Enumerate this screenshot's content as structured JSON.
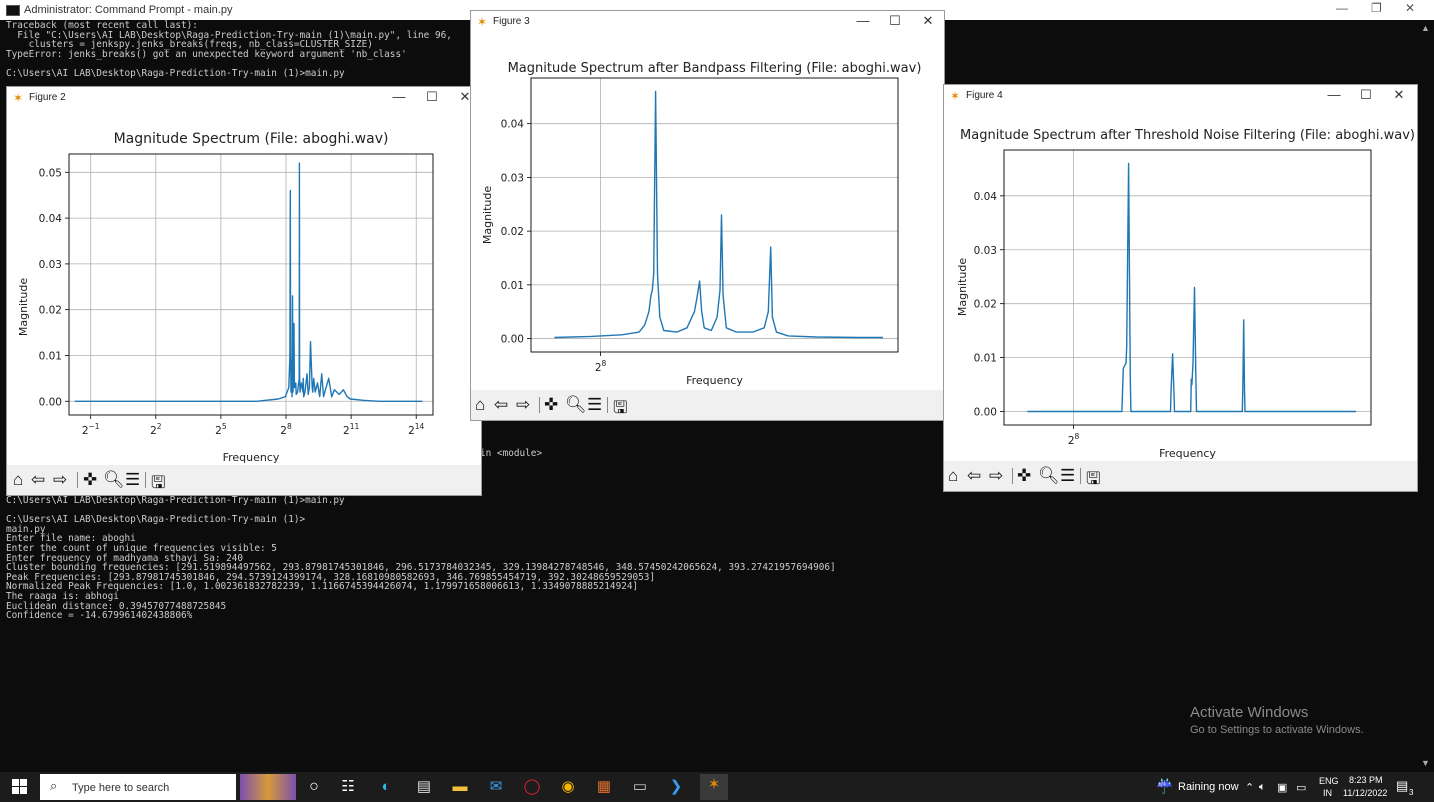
{
  "console": {
    "title": "Administrator: Command Prompt - main.py",
    "top_lines": [
      "Traceback (most recent call last):",
      "  File \"C:\\Users\\AI LAB\\Desktop\\Raga-Prediction-Try-main (1)\\main.py\", line 96,",
      "    clusters = jenkspy.jenks_breaks(freqs, nb_class=CLUSTER_SIZE)",
      "TypeError: jenks_breaks() got an unexpected keyword argument 'nb_class'",
      "",
      "C:\\Users\\AI LAB\\Desktop\\Raga-Prediction-Try-main (1)>main.py"
    ],
    "middle_fragment": "in <module>",
    "bottom_lines": [
      "C:\\Users\\AI LAB\\Desktop\\Raga-Prediction-Try-main (1)>main.py",
      "",
      "C:\\Users\\AI LAB\\Desktop\\Raga-Prediction-Try-main (1)>",
      "main.py",
      "Enter file name: aboghi",
      "Enter the count of unique frequencies visible: 5",
      "Enter frequency of madhyama sthayi Sa: 240",
      "Cluster bounding frequencies: [291.519894497562, 293.87981745301846, 296.5173784032345, 329.13984278748546, 348.57450242065624, 393.27421957694906]",
      "Peak Frequencies: [293.87981745301846, 294.5739124399174, 328.16810980582693, 346.769855454719, 392.30248659529053]",
      "Normalized Peak Frequencies: [1.0, 1.002361832782239, 1.1166745394426074, 1.179971658006613, 1.3349078885214924]",
      "The raaga is: abhogi",
      "Euclidean distance: 0.39457077488725845",
      "Confidence = -14.679961402438806%"
    ]
  },
  "activate_windows": {
    "line1": "Activate Windows",
    "line2": "Go to Settings to activate Windows."
  },
  "figures": [
    {
      "window_title": "Figure 2",
      "chart_data": {
        "type": "line",
        "title": "Magnitude Spectrum (File: aboghi.wav)",
        "xlabel": "Frequency",
        "ylabel": "Magnitude",
        "x_scale": "log2",
        "xlim": [
          0.25,
          28000
        ],
        "ylim": [
          -0.003,
          0.054
        ],
        "grid": true,
        "xticks": [
          {
            "base": "2",
            "exp": "−1",
            "value": 0.5
          },
          {
            "base": "2",
            "exp": "2",
            "value": 4
          },
          {
            "base": "2",
            "exp": "5",
            "value": 32
          },
          {
            "base": "2",
            "exp": "8",
            "value": 256
          },
          {
            "base": "2",
            "exp": "11",
            "value": 2048
          },
          {
            "base": "2",
            "exp": "14",
            "value": 16384
          }
        ],
        "yticks": [
          {
            "label": "0.00",
            "value": 0
          },
          {
            "label": "0.01",
            "value": 0.01
          },
          {
            "label": "0.02",
            "value": 0.02
          },
          {
            "label": "0.03",
            "value": 0.03
          },
          {
            "label": "0.04",
            "value": 0.04
          },
          {
            "label": "0.05",
            "value": 0.05
          }
        ],
        "series": [
          {
            "color": "#1f77b4",
            "x": [
              0.3,
              100,
              200,
              250,
              280,
              290,
              294,
              296,
              300,
              305,
              310,
              315,
              320,
              325,
              330,
              335,
              345,
              350,
              355,
              370,
              390,
              393,
              395,
              400,
              420,
              440,
              445,
              450,
              470,
              500,
              520,
              540,
              560,
              590,
              600,
              620,
              650,
              700,
              750,
              800,
              850,
              900,
              1000,
              1100,
              1200,
              1400,
              1600,
              1800,
              2000,
              3000,
              5000,
              10000,
              20000
            ],
            "y": [
              0,
              0,
              0.0005,
              0.001,
              0.003,
              0.01,
              0.046,
              0.01,
              0.002,
              0.009,
              0.001,
              0.023,
              0.002,
              0.012,
              0.017,
              0.003,
              0.003,
              0.004,
              0.0015,
              0.002,
              0.005,
              0.052,
              0.006,
              0.002,
              0.004,
              0.002,
              0.005,
              0.001,
              0.002,
              0.006,
              0.0015,
              0.003,
              0.013,
              0.003,
              0.002,
              0.005,
              0.002,
              0.004,
              0.001,
              0.006,
              0.001,
              0.0025,
              0.005,
              0.001,
              0.0025,
              0.0015,
              0.0025,
              0.001,
              0.0005,
              0.0002,
              0,
              0,
              0
            ]
          }
        ]
      }
    },
    {
      "window_title": "Figure 3",
      "chart_data": {
        "type": "line",
        "title": "Magnitude Spectrum after Bandpass Filtering (File: aboghi.wav)",
        "xlabel": "Frequency",
        "ylabel": "Magnitude",
        "x_scale": "log2",
        "xlim": [
          215,
          540
        ],
        "ylim": [
          -0.0025,
          0.0485
        ],
        "grid": true,
        "xticks": [
          {
            "base": "2",
            "exp": "8",
            "value": 256
          }
        ],
        "yticks": [
          {
            "label": "0.00",
            "value": 0
          },
          {
            "label": "0.01",
            "value": 0.01
          },
          {
            "label": "0.02",
            "value": 0.02
          },
          {
            "label": "0.03",
            "value": 0.03
          },
          {
            "label": "0.04",
            "value": 0.04
          }
        ],
        "series": [
          {
            "color": "#1f77b4",
            "x": [
              228,
              250,
              270,
              282,
              286,
              289,
              290.5,
              291.5,
              292.5,
              293.9,
              295.3,
              297,
              300,
              310,
              318,
              324,
              326,
              328.2,
              330,
              332,
              338,
              343,
              345.5,
              346.8,
              348.2,
              351,
              360,
              375,
              386,
              390,
              392.3,
              394,
              398,
              410,
              440,
              490,
              520
            ],
            "y": [
              0.0002,
              0.0004,
              0.0007,
              0.0012,
              0.0025,
              0.005,
              0.008,
              0.009,
              0.012,
              0.046,
              0.012,
              0.004,
              0.0015,
              0.0012,
              0.002,
              0.005,
              0.0075,
              0.0107,
              0.005,
              0.002,
              0.0015,
              0.004,
              0.009,
              0.023,
              0.008,
              0.002,
              0.0012,
              0.0012,
              0.002,
              0.005,
              0.017,
              0.004,
              0.0012,
              0.0005,
              0.0003,
              0.0002,
              0.0002
            ]
          }
        ]
      }
    },
    {
      "window_title": "Figure 4",
      "chart_data": {
        "type": "line",
        "title": "Magnitude Spectrum after Threshold Noise Filtering (File: aboghi.wav)",
        "xlabel": "Frequency",
        "ylabel": "Magnitude",
        "x_scale": "log2",
        "xlim": [
          215,
          540
        ],
        "ylim": [
          -0.0025,
          0.0485
        ],
        "grid": true,
        "xticks": [
          {
            "base": "2",
            "exp": "8",
            "value": 256
          }
        ],
        "yticks": [
          {
            "label": "0.00",
            "value": 0
          },
          {
            "label": "0.01",
            "value": 0.01
          },
          {
            "label": "0.02",
            "value": 0.02
          },
          {
            "label": "0.03",
            "value": 0.03
          },
          {
            "label": "0.04",
            "value": 0.04
          }
        ],
        "series": [
          {
            "color": "#1f77b4",
            "x": [
              228,
              289,
              289.5,
              290,
              291,
              292,
              292.5,
              293.9,
              295.2,
              295.6,
              326.5,
              327,
              328.2,
              329.3,
              329.8,
              343.5,
              344,
              344.5,
              345.5,
              346.8,
              348,
              348.5,
              391,
              391.5,
              392.3,
              393.1,
              393.6,
              520
            ],
            "y": [
              0,
              0,
              0.004,
              0.008,
              0.0085,
              0.009,
              0.012,
              0.046,
              0.006,
              0,
              0,
              0.004,
              0.0107,
              0.004,
              0,
              0,
              0.006,
              0.005,
              0.009,
              0.023,
              0.006,
              0,
              0,
              0.004,
              0.017,
              0.004,
              0,
              0
            ]
          }
        ]
      }
    }
  ],
  "taskbar": {
    "search_placeholder": "Type here to search",
    "weather": "Raining now",
    "lang_top": "ENG",
    "lang_bottom": "IN",
    "time": "8:23 PM",
    "date": "11/12/2022",
    "notification_count": "3"
  }
}
